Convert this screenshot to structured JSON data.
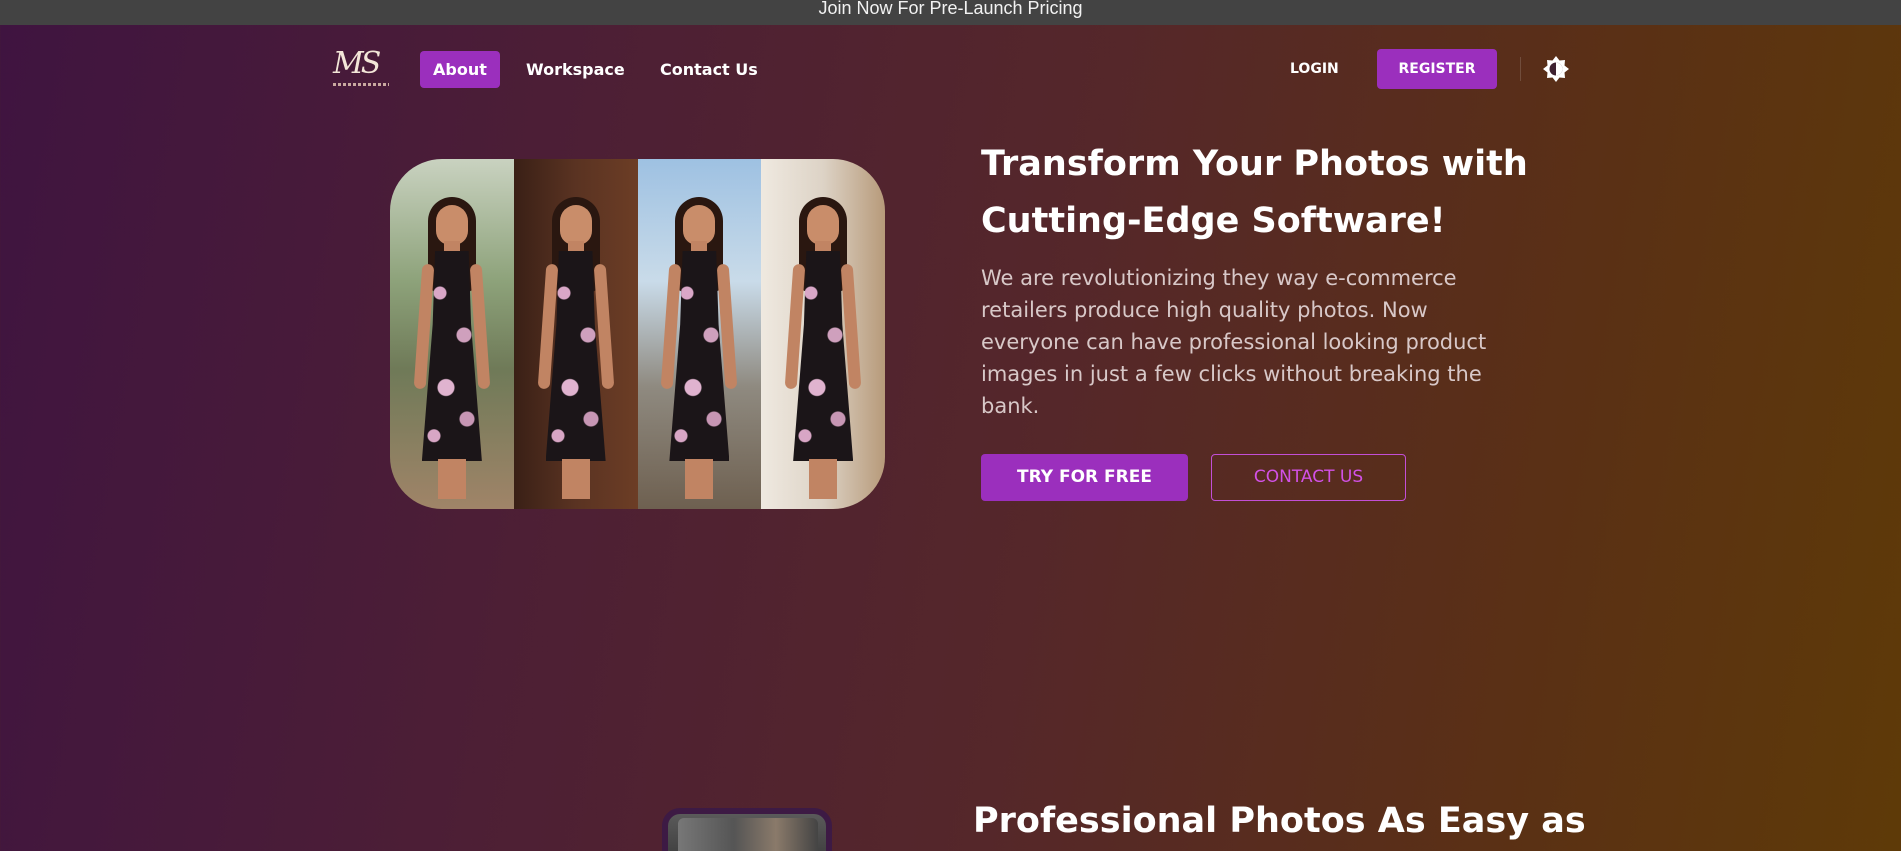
{
  "announcement": "Join Now For Pre-Launch Pricing",
  "logo": {
    "mark": "MS"
  },
  "nav": {
    "links": [
      {
        "label": "About",
        "active": true
      },
      {
        "label": "Workspace",
        "active": false
      },
      {
        "label": "Contact Us",
        "active": false
      }
    ],
    "login_label": "LOGIN",
    "register_label": "REGISTER",
    "theme_toggle_icon": "theme-toggle-icon"
  },
  "hero": {
    "title": "Transform Your Photos with Cutting-Edge Software!",
    "description": "We are revolutionizing they way e-commerce retailers produce high quality photos. Now everyone can have professional looking product images in just a few clicks without breaking the bank.",
    "primary_button": "TRY FOR FREE",
    "secondary_button": "CONTACT US"
  },
  "section2": {
    "title": "Professional Photos As Easy as"
  },
  "colors": {
    "accent": "#9b2fbd",
    "accent_text": "#d251e6",
    "topbar": "#434343"
  }
}
